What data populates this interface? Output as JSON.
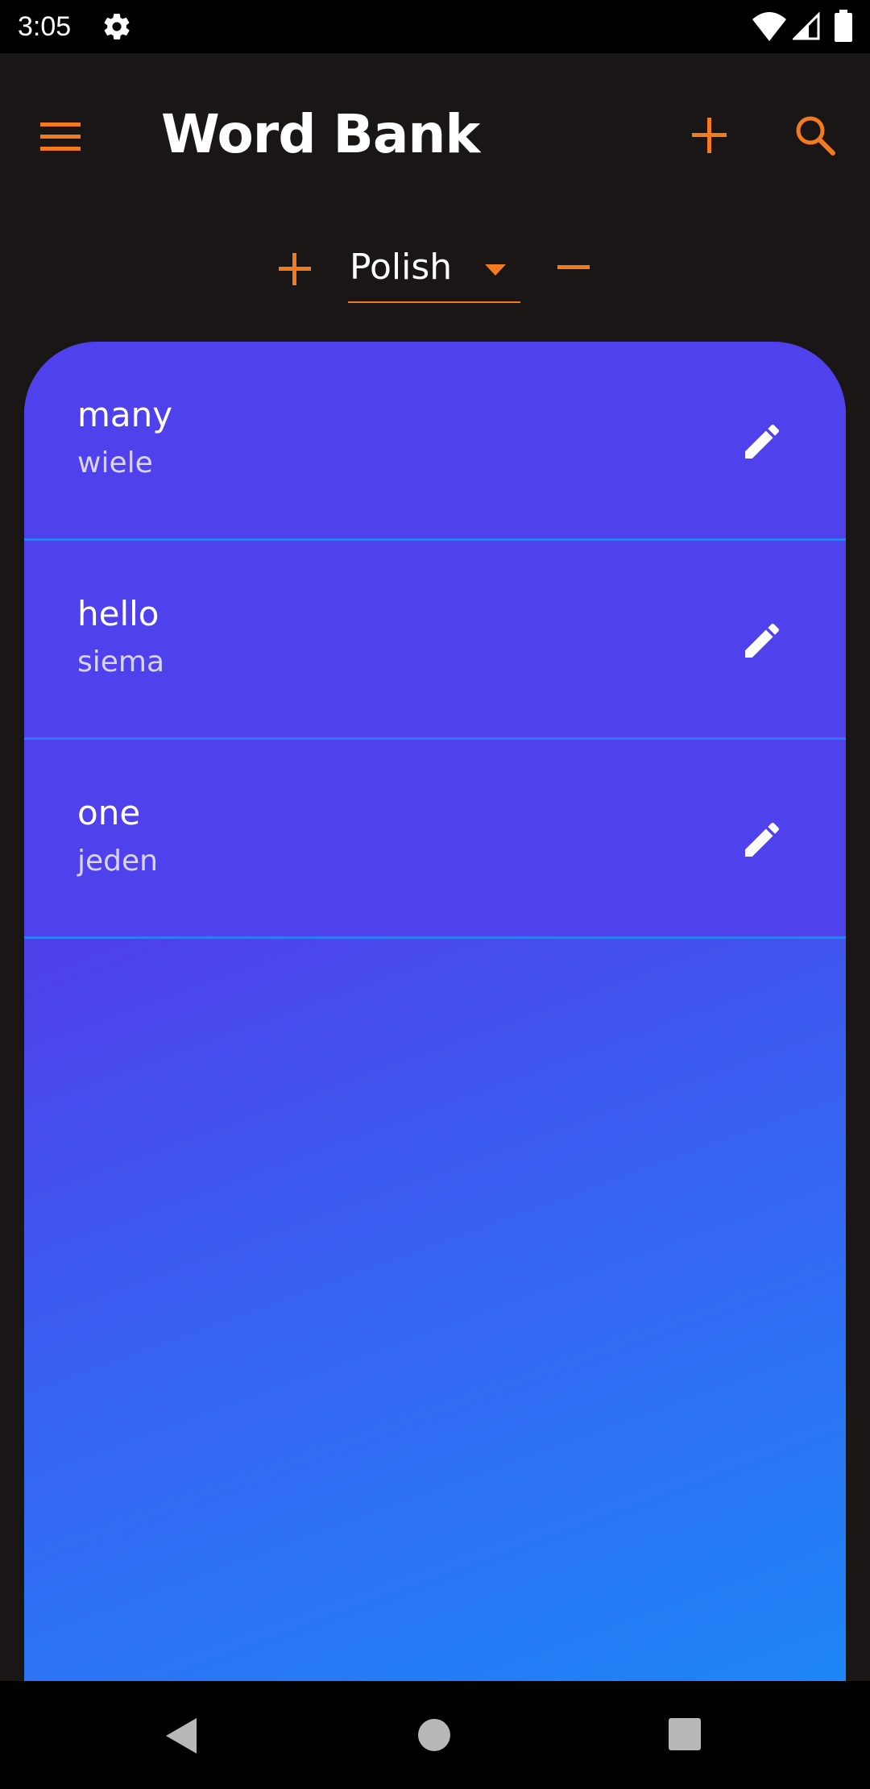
{
  "status_bar": {
    "time": "3:05",
    "icons": [
      "gear-icon",
      "wifi-icon",
      "signal-icon",
      "battery-icon"
    ]
  },
  "app_bar": {
    "title": "Word Bank",
    "icons": [
      "menu-icon",
      "plus-icon",
      "search-icon"
    ]
  },
  "language": {
    "selected": "Polish",
    "icons": [
      "plus-icon",
      "chevron-down-icon",
      "minus-icon"
    ]
  },
  "words": [
    {
      "word": "many",
      "translation": "wiele"
    },
    {
      "word": "hello",
      "translation": "siema"
    },
    {
      "word": "one",
      "translation": "jeden"
    }
  ],
  "nav_bar": {
    "icons": [
      "back-icon",
      "home-icon",
      "recents-icon"
    ]
  },
  "colors": {
    "accent": "#f27b1f",
    "background": "#1b1616",
    "card_top": "#4f41ec",
    "card_bottom": "#1e86f8",
    "divider": "#2f7cf4",
    "text": "#ffffff"
  }
}
